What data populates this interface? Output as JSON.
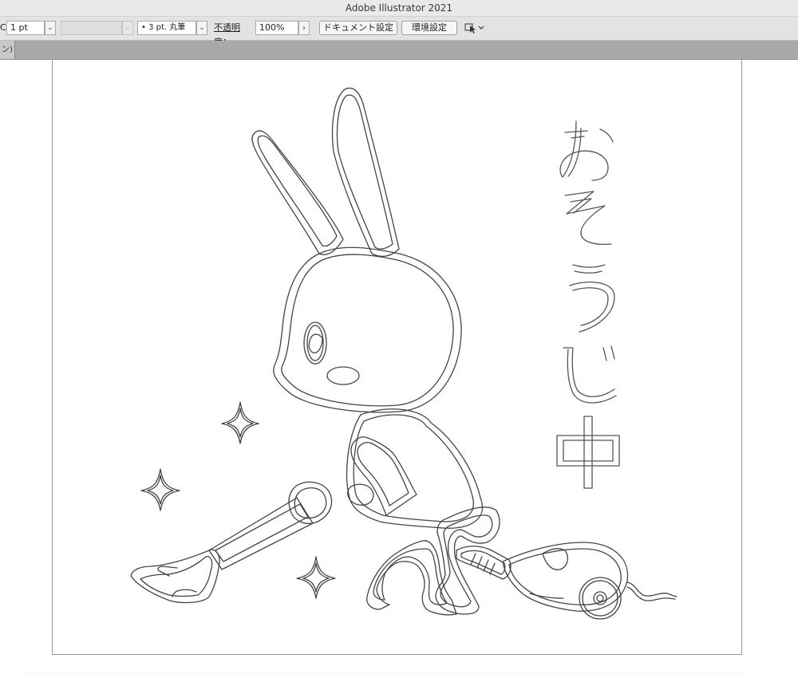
{
  "app": {
    "title": "Adobe Illustrator 2021"
  },
  "control_bar": {
    "stroke_weight": "1 pt",
    "variable_width_value": "",
    "brush_label": "•  3 pt. 丸筆",
    "opacity_label": "不透明度：",
    "opacity_value": "100%",
    "document_setup_button": "ドキュメント設定",
    "preferences_button": "環境設定",
    "stroke_cut_glyph": "C"
  },
  "document_tab": {
    "label": "ン)"
  },
  "artwork": {
    "vertical_text": "おそうじ中",
    "description_icons": [
      "rabbit-outline",
      "vacuum-cleaner-outline",
      "sparkle-icon",
      "sparkle-icon",
      "sparkle-icon"
    ]
  }
}
